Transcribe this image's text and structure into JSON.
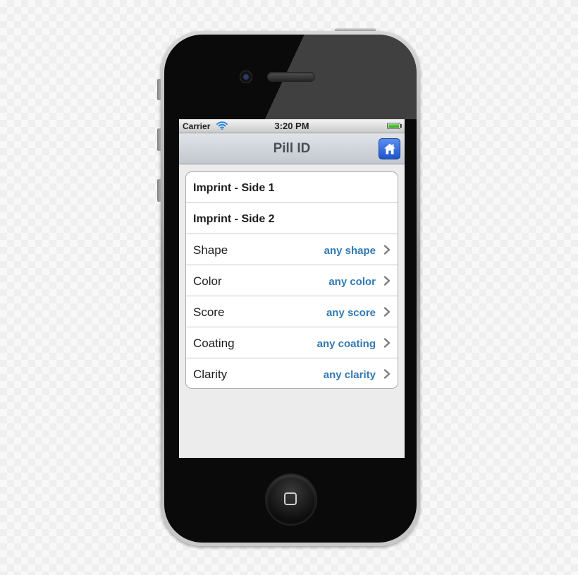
{
  "status_bar": {
    "carrier": "Carrier",
    "time": "3:20 PM",
    "battery_level": 1.0
  },
  "nav_bar": {
    "title": "Pill ID",
    "home_icon": "home-icon",
    "home_button_color": "#2a62d8"
  },
  "form": {
    "rows": [
      {
        "label": "Imprint - Side 1",
        "value": ""
      },
      {
        "label": "Imprint - Side 2",
        "value": ""
      },
      {
        "label": "Shape",
        "value": "any shape"
      },
      {
        "label": "Color",
        "value": "any color"
      },
      {
        "label": "Score",
        "value": "any score"
      },
      {
        "label": "Coating",
        "value": "any coating"
      },
      {
        "label": "Clarity",
        "value": "any clarity"
      }
    ]
  },
  "colors": {
    "accent_value": "#3179b3",
    "screen_background": "#ececec"
  }
}
